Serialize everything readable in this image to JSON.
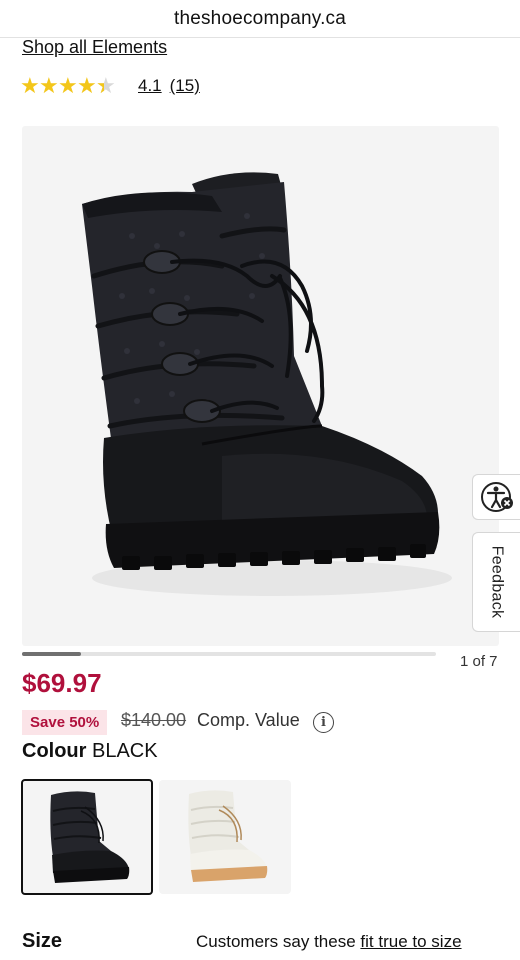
{
  "browser": {
    "url": "theshoecompany.ca"
  },
  "brand_link": "Shop all Elements",
  "rating": {
    "stars": 4.1,
    "max_stars": 5,
    "value": "4.1",
    "count": "(15)",
    "star_color": "#f3c61a"
  },
  "gallery": {
    "current_image": 1,
    "total_images": 7,
    "counter_text": "1 of 7",
    "product_color_shown": "black"
  },
  "side_tabs": {
    "accessibility_icon": "accessibility-icon",
    "feedback_label": "Feedback"
  },
  "pricing": {
    "sale_price": "$69.97",
    "save_badge": "Save 50%",
    "original_price": "$140.00",
    "comp_label": "Comp. Value",
    "info_icon": "info-icon",
    "sale_color": "#b0103c"
  },
  "colour": {
    "label": "Colour",
    "value": "BLACK"
  },
  "swatches": [
    {
      "name": "Black",
      "selected": true
    },
    {
      "name": "White",
      "selected": false
    }
  ],
  "size": {
    "label": "Size",
    "fit_prefix": "Customers say these",
    "fit_link": "fit true to size"
  }
}
